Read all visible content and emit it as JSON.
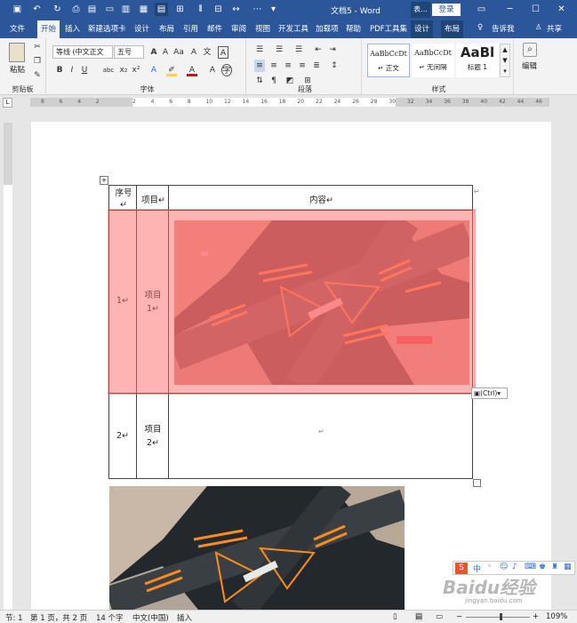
{
  "window": {
    "title": "文档5 - Word",
    "account_short": "表...",
    "login_label": "登录"
  },
  "tabs": [
    "文件",
    "开始",
    "插入",
    "新建选项卡",
    "设计",
    "布局",
    "引用",
    "邮件",
    "审阅",
    "视图",
    "开发工具",
    "加载项",
    "帮助",
    "PDF工具集",
    "设计",
    "布局"
  ],
  "active_tab": "开始",
  "tell_me": "告诉我",
  "share": "共享",
  "ribbon": {
    "clipboard": {
      "paste": "粘贴",
      "label": "剪贴板"
    },
    "font": {
      "name": "等线 (中文正文",
      "size": "五号",
      "label": "字体"
    },
    "paragraph": {
      "label": "段落"
    },
    "styles": {
      "label": "样式",
      "items": [
        {
          "preview": "AaBbCcDt",
          "name": "↵ 正文"
        },
        {
          "preview": "AaBbCcDt",
          "name": "↵ 无间隔"
        },
        {
          "preview": "AaBl",
          "name": "标题 1"
        }
      ]
    },
    "editing": {
      "label": "编辑"
    }
  },
  "ruler_numbers": [
    "8",
    "6",
    "4",
    "2",
    "",
    "2",
    "4",
    "6",
    "8",
    "10",
    "12",
    "14",
    "16",
    "18",
    "20",
    "22",
    "24",
    "26",
    "28",
    "30",
    "32",
    "34",
    "36",
    "38",
    "40",
    "42",
    "44",
    "46"
  ],
  "table": {
    "headers": [
      "序号↵",
      "项目↵",
      "内容↵"
    ],
    "rows": [
      {
        "num": "1↵",
        "item": "项目1↵",
        "content_type": "image"
      },
      {
        "num": "2↵",
        "item": "项目2↵",
        "content": "↵"
      }
    ]
  },
  "paste_options": "(Ctrl)",
  "status": {
    "section": "节: 1",
    "page": "第 1 页，共 2 页",
    "words": "14 个字",
    "language": "中文(中国)",
    "mode": "插入",
    "zoom": "109%"
  },
  "watermark": "Baidu经验",
  "watermark_url": "jingyan.baidu.com",
  "ime": "中"
}
